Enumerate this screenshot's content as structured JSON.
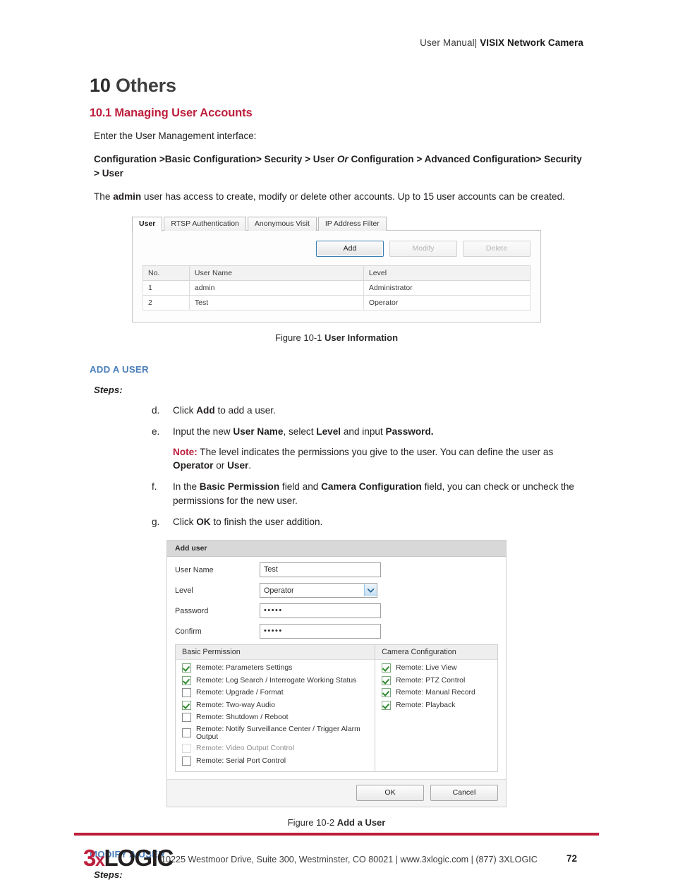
{
  "header": {
    "manual_label": "User Manual| ",
    "product": "VISIX Network Camera"
  },
  "chapter": {
    "number": "10",
    "title": "Others"
  },
  "section": {
    "number": "10.1",
    "title": "Managing User Accounts"
  },
  "intro": {
    "lead": "Enter the User Management interface:",
    "path_part1": "Configuration >Basic Configuration> Security > User ",
    "path_or": "Or",
    "path_part2": " Configuration > Advanced Configuration> Security > User",
    "admin_pre": "The ",
    "admin_bold": "admin",
    "admin_post": " user has access to create, modify or delete other accounts. Up to 15 user accounts can be created."
  },
  "figure1": {
    "tabs": [
      {
        "label": "User",
        "active": true
      },
      {
        "label": "RTSP Authentication",
        "active": false
      },
      {
        "label": "Anonymous Visit",
        "active": false
      },
      {
        "label": "IP Address Filter",
        "active": false
      }
    ],
    "buttons": [
      {
        "label": "Add",
        "state": "primary"
      },
      {
        "label": "Modify",
        "state": "disabled"
      },
      {
        "label": "Delete",
        "state": "disabled"
      }
    ],
    "table": {
      "columns": [
        "No.",
        "User Name",
        "Level"
      ],
      "rows": [
        {
          "no": "1",
          "user": "admin",
          "level": "Administrator"
        },
        {
          "no": "2",
          "user": "Test",
          "level": "Operator"
        }
      ]
    },
    "caption_label": "Figure 10-1 ",
    "caption_name": "User Information"
  },
  "add_user_section": {
    "heading": "ADD A USER",
    "steps_label": "Steps:",
    "steps": [
      {
        "marker": "d.",
        "pre": "Click ",
        "bold": "Add",
        "post": " to add a user."
      },
      {
        "marker": "e.",
        "pre": "Input the new ",
        "bold": "User Name",
        "mid": ", select ",
        "bold2": "Level",
        "mid2": " and input ",
        "bold3": "Password.",
        "note_label": "Note:",
        "note_text": " The level indicates the permissions you give to the user. You can define the user as ",
        "note_bold1": "Operator",
        "note_mid": " or ",
        "note_bold2": "User",
        "note_end": "."
      },
      {
        "marker": "f.",
        "pre": "In the ",
        "bold": "Basic Permission",
        "mid": " field and ",
        "bold2": "Camera Configuration",
        "post": " field, you can check or uncheck the permissions for the new user."
      },
      {
        "marker": "g.",
        "pre": "Click ",
        "bold": "OK",
        "post": " to finish the user addition."
      }
    ]
  },
  "figure2": {
    "dialog_title": "Add user",
    "fields": [
      {
        "label": "User Name",
        "value": "Test",
        "type": "text"
      },
      {
        "label": "Level",
        "value": "Operator",
        "type": "select"
      },
      {
        "label": "Password",
        "value": "•••••",
        "type": "password"
      },
      {
        "label": "Confirm",
        "value": "•••••",
        "type": "password"
      }
    ],
    "basic_permission": {
      "header": "Basic Permission",
      "items": [
        {
          "label": "Remote: Parameters Settings",
          "checked": true,
          "enabled": true
        },
        {
          "label": "Remote: Log Search / Interrogate Working Status",
          "checked": true,
          "enabled": true
        },
        {
          "label": "Remote: Upgrade / Format",
          "checked": false,
          "enabled": true
        },
        {
          "label": "Remote: Two-way Audio",
          "checked": true,
          "enabled": true
        },
        {
          "label": "Remote: Shutdown / Reboot",
          "checked": false,
          "enabled": true
        },
        {
          "label": "Remote: Notify Surveillance Center / Trigger Alarm Output",
          "checked": false,
          "enabled": true
        },
        {
          "label": "Remote: Video Output Control",
          "checked": false,
          "enabled": false
        },
        {
          "label": "Remote: Serial Port Control",
          "checked": false,
          "enabled": true
        }
      ]
    },
    "camera_configuration": {
      "header": "Camera Configuration",
      "items": [
        {
          "label": "Remote: Live View",
          "checked": true,
          "enabled": true
        },
        {
          "label": "Remote: PTZ Control",
          "checked": true,
          "enabled": true
        },
        {
          "label": "Remote: Manual Record",
          "checked": true,
          "enabled": true
        },
        {
          "label": "Remote: Playback",
          "checked": true,
          "enabled": true
        }
      ]
    },
    "ok_label": "OK",
    "cancel_label": "Cancel",
    "caption_label": "Figure 10-2 ",
    "caption_name": "Add a User"
  },
  "modify_user_section": {
    "heading": "MODIFY A USER",
    "steps_label": "Steps:"
  },
  "footer": {
    "logo_3": "3",
    "logo_x": "x",
    "logo_text": "LOGIC",
    "address": "10225 Westmoor Drive, Suite 300, Westminster, CO 80021 | www.3xlogic.com | (877) 3XLOGIC",
    "page_number": "72"
  },
  "colors": {
    "accent_red": "#bd1e3c",
    "subhead_blue": "#4a7ebb",
    "body_text": "#231f20"
  }
}
